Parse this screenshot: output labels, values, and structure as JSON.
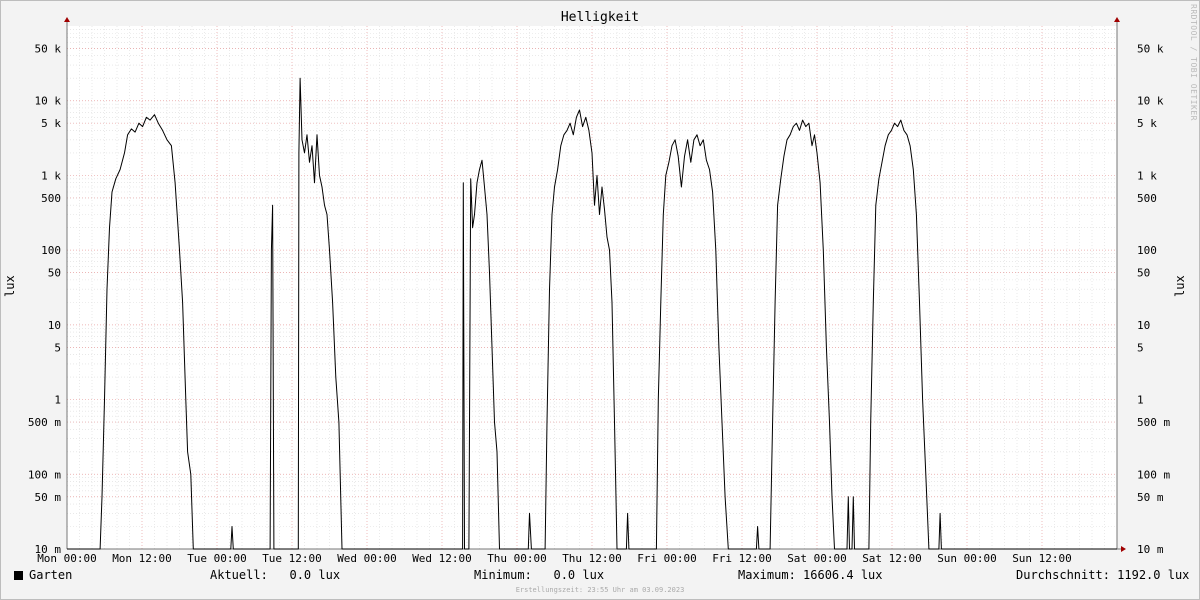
{
  "chart_data": {
    "type": "line",
    "title": "Helligkeit",
    "ylabel": "lux",
    "y_scale": "log",
    "ylim": [
      0.01,
      100000
    ],
    "grid": true,
    "y_ticks": [
      {
        "value": 50000,
        "label": "50 k"
      },
      {
        "value": 10000,
        "label": "10 k"
      },
      {
        "value": 5000,
        "label": "5 k"
      },
      {
        "value": 1000,
        "label": "1 k"
      },
      {
        "value": 500,
        "label": "500"
      },
      {
        "value": 100,
        "label": "100"
      },
      {
        "value": 50,
        "label": "50"
      },
      {
        "value": 10,
        "label": "10"
      },
      {
        "value": 5,
        "label": "5"
      },
      {
        "value": 1,
        "label": "1"
      },
      {
        "value": 0.5,
        "label": "500 m"
      },
      {
        "value": 0.1,
        "label": "100 m"
      },
      {
        "value": 0.05,
        "label": "50 m"
      },
      {
        "value": 0.01,
        "label": "10 m"
      }
    ],
    "x_unit": "hours",
    "xlim": [
      0,
      168
    ],
    "x_ticks": [
      {
        "value": 0,
        "label": "Mon 00:00"
      },
      {
        "value": 12,
        "label": "Mon 12:00"
      },
      {
        "value": 24,
        "label": "Tue 00:00"
      },
      {
        "value": 36,
        "label": "Tue 12:00"
      },
      {
        "value": 48,
        "label": "Wed 00:00"
      },
      {
        "value": 60,
        "label": "Wed 12:00"
      },
      {
        "value": 72,
        "label": "Thu 00:00"
      },
      {
        "value": 84,
        "label": "Thu 12:00"
      },
      {
        "value": 96,
        "label": "Fri 00:00"
      },
      {
        "value": 108,
        "label": "Fri 12:00"
      },
      {
        "value": 120,
        "label": "Sat 00:00"
      },
      {
        "value": 132,
        "label": "Sat 12:00"
      },
      {
        "value": 144,
        "label": "Sun 00:00"
      },
      {
        "value": 156,
        "label": "Sun 12:00"
      }
    ],
    "series": [
      {
        "name": "Garten",
        "color": "#000000",
        "points": [
          [
            0,
            0.01
          ],
          [
            5.3,
            0.01
          ],
          [
            5.6,
            0.05
          ],
          [
            6.0,
            1
          ],
          [
            6.4,
            30
          ],
          [
            6.8,
            200
          ],
          [
            7.2,
            600
          ],
          [
            7.8,
            900
          ],
          [
            8.5,
            1200
          ],
          [
            9.2,
            2000
          ],
          [
            9.7,
            3500
          ],
          [
            10.3,
            4200
          ],
          [
            10.9,
            3800
          ],
          [
            11.5,
            5000
          ],
          [
            12.1,
            4500
          ],
          [
            12.7,
            6000
          ],
          [
            13.3,
            5500
          ],
          [
            14.0,
            6500
          ],
          [
            14.6,
            5000
          ],
          [
            15.3,
            4000
          ],
          [
            16.0,
            3000
          ],
          [
            16.7,
            2500
          ],
          [
            17.3,
            800
          ],
          [
            18.0,
            100
          ],
          [
            18.5,
            20
          ],
          [
            19.0,
            1
          ],
          [
            19.3,
            0.2
          ],
          [
            19.8,
            0.1
          ],
          [
            20.2,
            0.01
          ],
          [
            26.2,
            0.01
          ],
          [
            26.4,
            0.02
          ],
          [
            26.6,
            0.01
          ],
          [
            32.5,
            0.01
          ],
          [
            32.7,
            100
          ],
          [
            32.9,
            400
          ],
          [
            33.1,
            0.01
          ],
          [
            37.0,
            0.01
          ],
          [
            37.1,
            2000
          ],
          [
            37.3,
            20000
          ],
          [
            37.6,
            3000
          ],
          [
            38.0,
            2000
          ],
          [
            38.4,
            3500
          ],
          [
            38.8,
            1500
          ],
          [
            39.2,
            2500
          ],
          [
            39.6,
            800
          ],
          [
            40.0,
            3500
          ],
          [
            40.4,
            1000
          ],
          [
            40.8,
            700
          ],
          [
            41.2,
            400
          ],
          [
            41.6,
            300
          ],
          [
            42.0,
            100
          ],
          [
            42.5,
            20
          ],
          [
            43.0,
            2
          ],
          [
            43.5,
            0.5
          ],
          [
            44.0,
            0.01
          ],
          [
            63.3,
            0.01
          ],
          [
            63.4,
            800
          ],
          [
            63.6,
            0.01
          ],
          [
            64.3,
            0.01
          ],
          [
            64.6,
            900
          ],
          [
            64.9,
            200
          ],
          [
            65.2,
            300
          ],
          [
            65.6,
            800
          ],
          [
            66.0,
            1200
          ],
          [
            66.4,
            1600
          ],
          [
            66.8,
            700
          ],
          [
            67.2,
            300
          ],
          [
            67.6,
            50
          ],
          [
            68.0,
            5
          ],
          [
            68.4,
            0.5
          ],
          [
            68.8,
            0.2
          ],
          [
            69.2,
            0.01
          ],
          [
            73.8,
            0.01
          ],
          [
            74.0,
            0.03
          ],
          [
            74.3,
            0.01
          ],
          [
            76.5,
            0.01
          ],
          [
            76.8,
            0.5
          ],
          [
            77.2,
            30
          ],
          [
            77.6,
            300
          ],
          [
            78.0,
            700
          ],
          [
            78.5,
            1200
          ],
          [
            79.0,
            2500
          ],
          [
            79.5,
            3500
          ],
          [
            80.0,
            4000
          ],
          [
            80.5,
            5000
          ],
          [
            81.0,
            3500
          ],
          [
            81.5,
            6000
          ],
          [
            82.0,
            7500
          ],
          [
            82.5,
            4500
          ],
          [
            83.0,
            6000
          ],
          [
            83.5,
            4000
          ],
          [
            84.0,
            2000
          ],
          [
            84.4,
            400
          ],
          [
            84.8,
            1000
          ],
          [
            85.2,
            300
          ],
          [
            85.6,
            700
          ],
          [
            86.0,
            350
          ],
          [
            86.4,
            150
          ],
          [
            86.8,
            100
          ],
          [
            87.2,
            20
          ],
          [
            87.6,
            0.5
          ],
          [
            88.0,
            0.01
          ],
          [
            89.5,
            0.01
          ],
          [
            89.7,
            0.03
          ],
          [
            89.9,
            0.01
          ],
          [
            94.3,
            0.01
          ],
          [
            94.6,
            1
          ],
          [
            95.0,
            20
          ],
          [
            95.4,
            300
          ],
          [
            95.8,
            1000
          ],
          [
            96.3,
            1500
          ],
          [
            96.8,
            2500
          ],
          [
            97.3,
            3000
          ],
          [
            97.8,
            1800
          ],
          [
            98.3,
            700
          ],
          [
            98.8,
            1800
          ],
          [
            99.3,
            3000
          ],
          [
            99.8,
            1500
          ],
          [
            100.3,
            3000
          ],
          [
            100.8,
            3500
          ],
          [
            101.3,
            2500
          ],
          [
            101.8,
            3000
          ],
          [
            102.3,
            1600
          ],
          [
            102.8,
            1200
          ],
          [
            103.3,
            600
          ],
          [
            103.8,
            100
          ],
          [
            104.3,
            5
          ],
          [
            104.8,
            0.5
          ],
          [
            105.3,
            0.05
          ],
          [
            105.8,
            0.01
          ],
          [
            110.3,
            0.01
          ],
          [
            110.5,
            0.02
          ],
          [
            110.7,
            0.01
          ],
          [
            112.5,
            0.01
          ],
          [
            112.9,
            0.5
          ],
          [
            113.3,
            20
          ],
          [
            113.7,
            400
          ],
          [
            114.2,
            900
          ],
          [
            114.7,
            1800
          ],
          [
            115.2,
            3000
          ],
          [
            115.7,
            3500
          ],
          [
            116.2,
            4500
          ],
          [
            116.7,
            5000
          ],
          [
            117.2,
            4000
          ],
          [
            117.7,
            5500
          ],
          [
            118.2,
            4500
          ],
          [
            118.7,
            5000
          ],
          [
            119.2,
            2500
          ],
          [
            119.6,
            3500
          ],
          [
            120.0,
            2000
          ],
          [
            120.5,
            800
          ],
          [
            121.0,
            100
          ],
          [
            121.5,
            5
          ],
          [
            122.0,
            0.5
          ],
          [
            122.4,
            0.05
          ],
          [
            122.8,
            0.01
          ],
          [
            124.8,
            0.01
          ],
          [
            125.0,
            0.05
          ],
          [
            125.2,
            0.01
          ],
          [
            125.6,
            0.01
          ],
          [
            125.8,
            0.05
          ],
          [
            126.0,
            0.01
          ],
          [
            128.3,
            0.01
          ],
          [
            128.6,
            0.5
          ],
          [
            129.0,
            20
          ],
          [
            129.4,
            400
          ],
          [
            129.9,
            900
          ],
          [
            130.4,
            1500
          ],
          [
            130.9,
            2500
          ],
          [
            131.4,
            3500
          ],
          [
            131.9,
            4000
          ],
          [
            132.4,
            5000
          ],
          [
            132.9,
            4500
          ],
          [
            133.4,
            5500
          ],
          [
            133.9,
            4000
          ],
          [
            134.4,
            3500
          ],
          [
            134.9,
            2500
          ],
          [
            135.4,
            1200
          ],
          [
            135.9,
            300
          ],
          [
            136.4,
            20
          ],
          [
            136.9,
            1
          ],
          [
            137.4,
            0.1
          ],
          [
            137.9,
            0.01
          ],
          [
            139.5,
            0.01
          ],
          [
            139.7,
            0.03
          ],
          [
            139.9,
            0.01
          ],
          [
            168,
            0.01
          ]
        ]
      }
    ]
  },
  "legend": {
    "series_name": "Garten",
    "current_label": "Aktuell:",
    "current_value": "0.0 lux",
    "min_label": "Minimum:",
    "min_value": "0.0 lux",
    "max_label": "Maximum:",
    "max_value": "16606.4 lux",
    "avg_label": "Durchschnitt:",
    "avg_value": "1192.0 lux"
  },
  "watermark": "RRDTOOL / TOBI OETIKER",
  "footer": "Erstellungszeit: 23:55 Uhr am 03.09.2023"
}
